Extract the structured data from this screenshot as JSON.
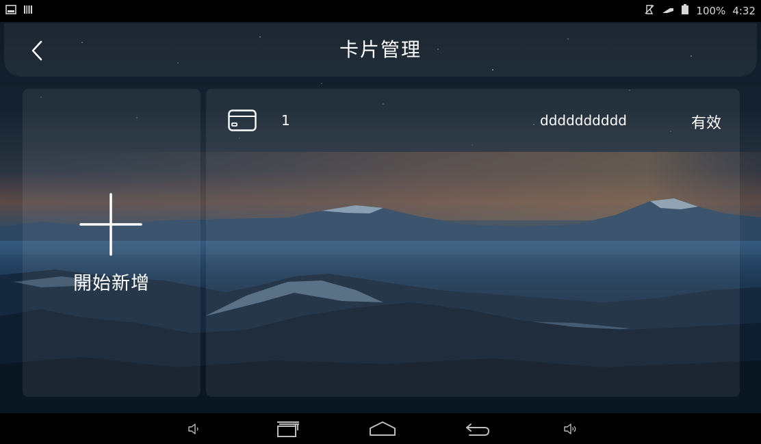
{
  "status_bar": {
    "battery_percent": "100%",
    "time": "4:32",
    "icons": [
      "picture-icon",
      "barcode-icon",
      "mute-icon",
      "signal-icon",
      "battery-icon"
    ]
  },
  "header": {
    "title": "卡片管理",
    "back_icon": "chevron-left-icon"
  },
  "add_panel": {
    "label": "開始新增",
    "icon": "plus-icon"
  },
  "cards": [
    {
      "index": "1",
      "number": "dddddddddd",
      "status": "有效",
      "icon": "card-icon"
    }
  ],
  "nav_bar": {
    "buttons": [
      "volume-down-icon",
      "recent-apps-icon",
      "home-icon",
      "back-icon",
      "volume-up-icon"
    ]
  },
  "colors": {
    "background": "#000000",
    "text": "#ffffff",
    "panel": "rgba(255,255,255,0.07)"
  }
}
